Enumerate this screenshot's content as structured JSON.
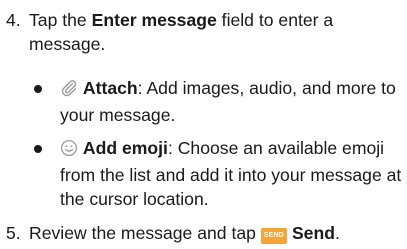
{
  "step4": {
    "number": "4.",
    "pre": "Tap the ",
    "field": "Enter message",
    "post": " field to enter a message."
  },
  "bullets": [
    {
      "icon": "paperclip-icon",
      "label": "Attach",
      "text": ": Add images, audio, and more to your message."
    },
    {
      "icon": "smiley-icon",
      "label": "Add emoji",
      "text": ": Choose an available emoji from the list and add it into your message at the cursor location."
    }
  ],
  "step5": {
    "number": "5.",
    "pre": "Review the message and tap ",
    "badge": "SEND",
    "label": "Send",
    "post": "."
  },
  "colors": {
    "text": "#1a1a1a",
    "icon_gray": "#9a9a9a",
    "send_badge": "#f3a53a"
  }
}
